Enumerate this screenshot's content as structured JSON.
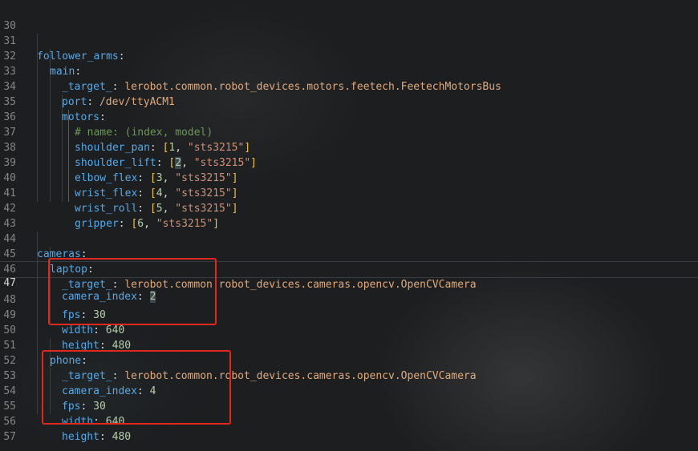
{
  "editor": {
    "current_line": 47,
    "colors": {
      "key": "#56a9e8",
      "string": "#ce9178",
      "number": "#b5cea8",
      "comment": "#6a9955",
      "bracket": "#f0c34a",
      "highlight_box": "#e0281e"
    },
    "lines": [
      {
        "no": "30"
      },
      {
        "no": "31",
        "key": "follower_arms",
        "colon": ":"
      },
      {
        "no": "32",
        "key": "main",
        "colon": ":"
      },
      {
        "no": "33",
        "key": "_target_",
        "colon": ": ",
        "value": "lerobot.common.robot_devices.motors.feetech.FeetechMotorsBus"
      },
      {
        "no": "34",
        "key": "port",
        "colon": ": ",
        "value": "/dev/ttyACM1"
      },
      {
        "no": "35",
        "key": "motors",
        "colon": ":"
      },
      {
        "no": "36",
        "comment": "# name: (index, model)"
      },
      {
        "no": "37",
        "key": "shoulder_pan",
        "colon": ": ",
        "lb": "[",
        "num": "1",
        "sep": ", ",
        "str": "\"sts3215\"",
        "rb": "]"
      },
      {
        "no": "38",
        "key": "shoulder_lift",
        "colon": ": ",
        "lb": "[",
        "num": "2",
        "sep": ", ",
        "str": "\"sts3215\"",
        "rb": "]"
      },
      {
        "no": "39",
        "key": "elbow_flex",
        "colon": ": ",
        "lb": "[",
        "num": "3",
        "sep": ", ",
        "str": "\"sts3215\"",
        "rb": "]"
      },
      {
        "no": "40",
        "key": "wrist_flex",
        "colon": ": ",
        "lb": "[",
        "num": "4",
        "sep": ", ",
        "str": "\"sts3215\"",
        "rb": "]"
      },
      {
        "no": "41",
        "key": "wrist_roll",
        "colon": ": ",
        "lb": "[",
        "num": "5",
        "sep": ", ",
        "str": "\"sts3215\"",
        "rb": "]"
      },
      {
        "no": "42",
        "key": "gripper",
        "colon": ": ",
        "lb": "[",
        "num": "6",
        "sep": ", ",
        "str": "\"sts3215\"",
        "rb": "]"
      },
      {
        "no": "43"
      },
      {
        "no": "44",
        "key": "cameras",
        "colon": ":"
      },
      {
        "no": "45",
        "key": "laptop",
        "colon": ":"
      },
      {
        "no": "46",
        "key": "_target_",
        "colon": ": ",
        "value": "lerobot.common.robot_devices.cameras.opencv.OpenCVCamera"
      },
      {
        "no": "47",
        "key": "camera_index",
        "colon": ": ",
        "num": "2"
      },
      {
        "no": "48",
        "key": "fps",
        "colon": ": ",
        "num": "30"
      },
      {
        "no": "49",
        "key": "width",
        "colon": ": ",
        "num": "640"
      },
      {
        "no": "50",
        "key": "height",
        "colon": ": ",
        "num": "480"
      },
      {
        "no": "51",
        "key": "phone",
        "colon": ":"
      },
      {
        "no": "52",
        "key": "_target_",
        "colon": ": ",
        "value": "lerobot.common.robot_devices.cameras.opencv.OpenCVCamera"
      },
      {
        "no": "53",
        "key": "camera_index",
        "colon": ": ",
        "num": "4"
      },
      {
        "no": "54",
        "key": "fps",
        "colon": ": ",
        "num": "30"
      },
      {
        "no": "55",
        "key": "width",
        "colon": ": ",
        "num": "640"
      },
      {
        "no": "56",
        "key": "height",
        "colon": ": ",
        "num": "480"
      },
      {
        "no": "57"
      }
    ]
  }
}
